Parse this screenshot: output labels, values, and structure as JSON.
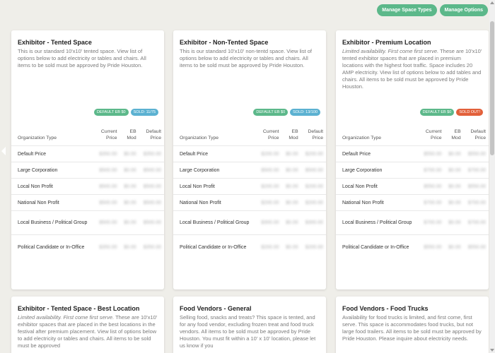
{
  "header": {
    "buttons": [
      "Manage Space Types",
      "Manage Options"
    ]
  },
  "table_headers": {
    "org": "Organization Type",
    "current": [
      "Current",
      "Price"
    ],
    "eb": [
      "EB",
      "Mod"
    ],
    "default": [
      "Default",
      "Price"
    ]
  },
  "cards": [
    {
      "title": "Exhibitor - Tented Space",
      "description": "This is our standard 10'x10' tented space.  View list of options below to add electricity or tables and chairs. All items to be sold must be approved by Pride Houston.",
      "badges": [
        {
          "text": "DEFAULT EB $0",
          "color": "#5cb88a"
        },
        {
          "text": "SOLD: 11/75",
          "color": "#5bb1d1"
        }
      ],
      "rows": [
        {
          "org": "Default Price",
          "current": "$350.00",
          "eb": "$0.00",
          "default": "$350.00"
        },
        {
          "org": "Large Corporation",
          "current": "$500.00",
          "eb": "$0.00",
          "default": "$500.00"
        },
        {
          "org": "Local Non Profit",
          "current": "$500.00",
          "eb": "$0.00",
          "default": "$500.00"
        },
        {
          "org": "National Non Profit",
          "current": "$500.00",
          "eb": "$0.00",
          "default": "$500.00"
        },
        {
          "org": "Local Business / Political Group",
          "current": "$500.00",
          "eb": "$0.00",
          "default": "$500.00"
        },
        {
          "org": "Political Candidate or In-Office",
          "current": "$350.00",
          "eb": "$0.00",
          "default": "$350.00"
        }
      ]
    },
    {
      "title": "Exhibitor - Non-Tented Space",
      "description": "This is our standard 10'x10' non-tentd space.  View list of options below to add electricity or tables and chairs. All items to be sold must be approved by Pride Houston.",
      "badges": [
        {
          "text": "DEFAULT EB $0",
          "color": "#5cb88a"
        },
        {
          "text": "SOLD: 13/100",
          "color": "#5bb1d1"
        }
      ],
      "rows": [
        {
          "org": "Default Price",
          "current": "$200.00",
          "eb": "$0.00",
          "default": "$200.00"
        },
        {
          "org": "Large Corporation",
          "current": "$500.00",
          "eb": "$0.00",
          "default": "$500.00"
        },
        {
          "org": "Local Non Profit",
          "current": "$200.00",
          "eb": "$0.00",
          "default": "$200.00"
        },
        {
          "org": "National Non Profit",
          "current": "$200.00",
          "eb": "$0.00",
          "default": "$200.00"
        },
        {
          "org": "Local Business / Political Group",
          "current": "$300.00",
          "eb": "$0.00",
          "default": "$300.00"
        },
        {
          "org": "Political Candidate or In-Office",
          "current": "$200.00",
          "eb": "$0.00",
          "default": "$200.00"
        }
      ]
    },
    {
      "title": "Exhibitor - Premium Location",
      "description": "Limited availability. First come first serve. These are 10'x10' tented exhibitor spaces that are placed in premium locations with the highest foot traffic.  Space includes 20 AMP electricity. View list of options below to add tables and chairs. All items to be sold must be approved by Pride Houston.",
      "badges": [
        {
          "text": "DEFAULT EB $0",
          "color": "#5cb88a"
        },
        {
          "text": "SOLD OUT!",
          "color": "#e2603a"
        }
      ],
      "rows": [
        {
          "org": "Default Price",
          "current": "$550.00",
          "eb": "$0.00",
          "default": "$550.00"
        },
        {
          "org": "Large Corporation",
          "current": "$700.00",
          "eb": "$0.00",
          "default": "$700.00"
        },
        {
          "org": "Local Non Profit",
          "current": "$550.00",
          "eb": "$0.00",
          "default": "$550.00"
        },
        {
          "org": "National Non Profit",
          "current": "$700.00",
          "eb": "$0.00",
          "default": "$700.00"
        },
        {
          "org": "Local Business / Political Group",
          "current": "$700.00",
          "eb": "$0.00",
          "default": "$700.00"
        },
        {
          "org": "Political Candidate or In-Office",
          "current": "$550.00",
          "eb": "$0.00",
          "default": "$550.00"
        }
      ]
    }
  ],
  "lower_cards": [
    {
      "title": "Exhibitor - Tented Space - Best Location",
      "description": "Limited availability. First come first serve. These are 10'x10' exhibitor spaces that are placed in the best locations in the festival after premium placement. View list of options below to add electricity or tables and chairs. All items to be sold must be approved"
    },
    {
      "title": "Food Vendors - General",
      "description": "Selling food, snacks and treats?  This space is tented, and for any food vendor, excluding frozen treat and food truck vendors.  All items to be sold must be approved by Pride Houston.  You must fit within a 10' x 10' location, please let us know if you"
    },
    {
      "title": "Food Vendors - Food Trucks",
      "description": "Availability for food trucks is limited, and first come, first serve.  This space is accommodates food trucks, but not large food trailers.  All items to be sold must be approved by Pride Houston.  Please inquire about electricity needs."
    }
  ]
}
